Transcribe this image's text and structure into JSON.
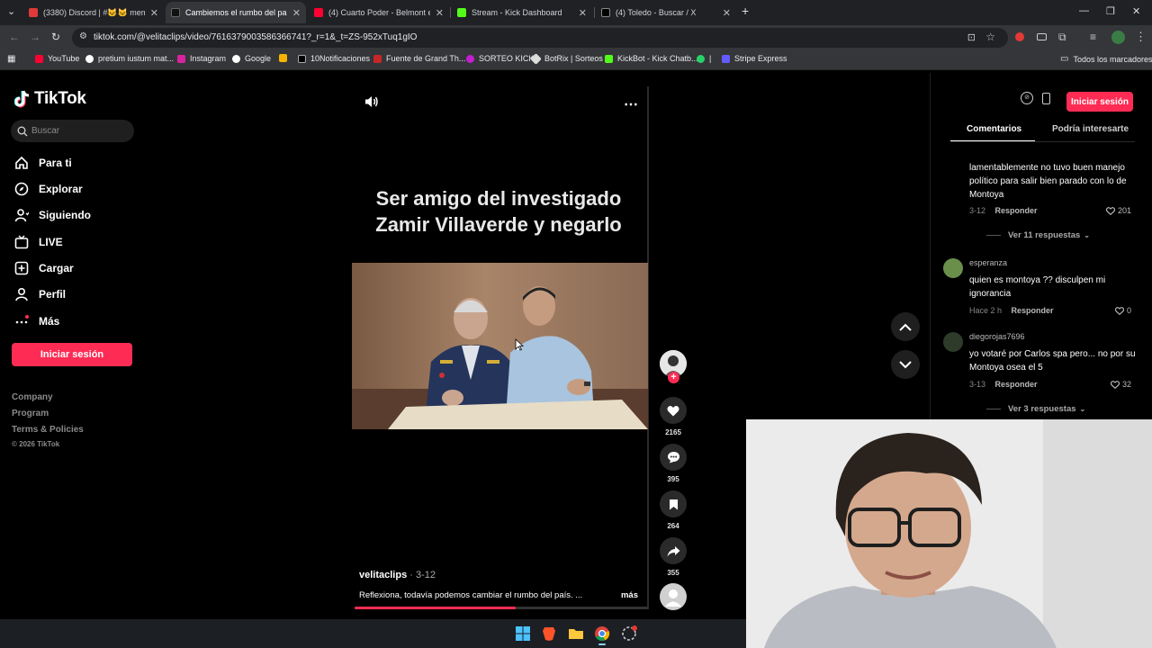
{
  "browser": {
    "tabs": [
      {
        "title": "(3380) Discord | #🐱🐱 memes",
        "active": false
      },
      {
        "title": "Cambiemos el rumbo del país",
        "active": true
      },
      {
        "title": "(4) Cuarto Poder - Belmont en",
        "active": false
      },
      {
        "title": "Stream - Kick Dashboard",
        "active": false
      },
      {
        "title": "(4) Toledo - Buscar / X",
        "active": false
      }
    ],
    "url": "tiktok.com/@velitaclips/video/7616379003586366741?_r=1&_t=ZS-952xTuq1gIO",
    "bookmarks": [
      "YouTube",
      "pretium iustum mat...",
      "Instagram",
      "Google",
      "10Notificaciones",
      "Fuente de Grand Th...",
      "SORTEO KICK",
      "BotRix | Sorteos",
      "KickBot - Kick Chatb...",
      "|",
      "Stripe Express"
    ],
    "all_bookmarks": "Todos los marcadores",
    "colors": {
      "tabbar": "#202124",
      "toolbar": "#35363a"
    }
  },
  "sidebar": {
    "logo": "TikTok",
    "search_placeholder": "Buscar",
    "nav": [
      {
        "label": "Para ti",
        "icon": "home-icon"
      },
      {
        "label": "Explorar",
        "icon": "compass-icon"
      },
      {
        "label": "Siguiendo",
        "icon": "user-follow-icon"
      },
      {
        "label": "LIVE",
        "icon": "live-icon"
      },
      {
        "label": "Cargar",
        "icon": "upload-icon"
      },
      {
        "label": "Perfil",
        "icon": "profile-icon"
      },
      {
        "label": "Más",
        "icon": "more-icon"
      }
    ],
    "login": "Iniciar sesión",
    "footer": [
      "Company",
      "Program",
      "Terms & Policies"
    ],
    "copyright": "© 2026 TikTok"
  },
  "video": {
    "overlay_text_line1": "Ser amigo del investigado",
    "overlay_text_line2": "Zamir Villaverde y negarlo",
    "username": "velitaclips",
    "date": "· 3-12",
    "description": "Reflexiona, todavía podemos cambiar el rumbo del país. ...",
    "more": "más",
    "progress": 0.55,
    "likes": "2165",
    "comments": "395",
    "saves": "264",
    "shares": "355"
  },
  "right_panel": {
    "login": "Iniciar sesión",
    "tabs": [
      "Comentarios",
      "Podría interesarte"
    ],
    "comments": [
      {
        "user": "",
        "text": "lamentablemente no tuvo buen manejo político para salir bien parado con lo de Montoya",
        "date": "3-12",
        "reply": "Responder",
        "likes": "201",
        "replies": "Ver 11 respuestas"
      },
      {
        "user": "esperanza",
        "text": "quien es montoya ?? disculpen mi ignorancia",
        "date": "Hace 2 h",
        "reply": "Responder",
        "likes": "0",
        "replies": ""
      },
      {
        "user": "diegorojas7696",
        "text": "yo votaré por Carlos spa pero... no por su Montoya osea el 5",
        "date": "3-13",
        "reply": "Responder",
        "likes": "32",
        "replies": "Ver 3 respuestas"
      }
    ],
    "accent": "#fe2c55"
  }
}
